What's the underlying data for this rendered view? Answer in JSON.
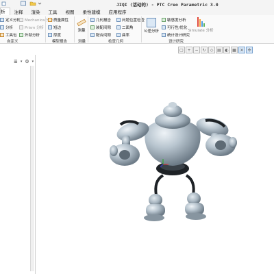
{
  "window": {
    "title": "JIQI (活动的) - PTC Creo Parametric 3.0"
  },
  "quick_access": {
    "folder_icon": "folder-icon",
    "dropdown_icon": "chevron-down-icon"
  },
  "menu": {
    "tabs": [
      {
        "label": "析"
      },
      {
        "label": "注释"
      },
      {
        "label": "渲染"
      },
      {
        "label": "工具"
      },
      {
        "label": "视图"
      },
      {
        "label": "柔性建模"
      },
      {
        "label": "应用程序"
      }
    ]
  },
  "ribbon": {
    "col1": [
      "定义分析",
      "分析",
      "工具包"
    ],
    "col2": [
      "Mechanica 分析",
      "Prism 分析",
      "外部分析"
    ],
    "col3": [
      "质量属性",
      "短边",
      "厚度"
    ],
    "measure": "测量",
    "col4": [
      "几何报告",
      "装配间隙",
      "配合间隙"
    ],
    "col5": [
      "问题位置检查",
      "二面角",
      "曲率"
    ],
    "user_analysis": "公差分析",
    "col6": [
      "敏感度分析",
      "可行性/优化",
      "统计设计研究"
    ],
    "simulate": "Simulate 分析",
    "groups": {
      "custom": "自定义",
      "model_report": "模型报告",
      "measure": "测量",
      "inspect": "检查几何",
      "design_study": "设计研究"
    }
  },
  "graphics_toolbar": {
    "icons": [
      "refit-icon",
      "zoom-in-icon",
      "zoom-out-icon",
      "repaint-icon",
      "orient-icon",
      "saved-views-icon",
      "display-style-icon",
      "view-manager-icon",
      "annotation-display-icon",
      "spin-center-icon"
    ]
  },
  "navigator": {
    "tree_icon": "model-tree-icon",
    "settings_icon": "settings-icon",
    "filter_icon": "filter-icon"
  },
  "colors": {
    "ribbon_bg": "#fafafa",
    "model_body": "#aab8c2",
    "model_dark": "#1e2226",
    "accent": "#6b8fb8"
  }
}
